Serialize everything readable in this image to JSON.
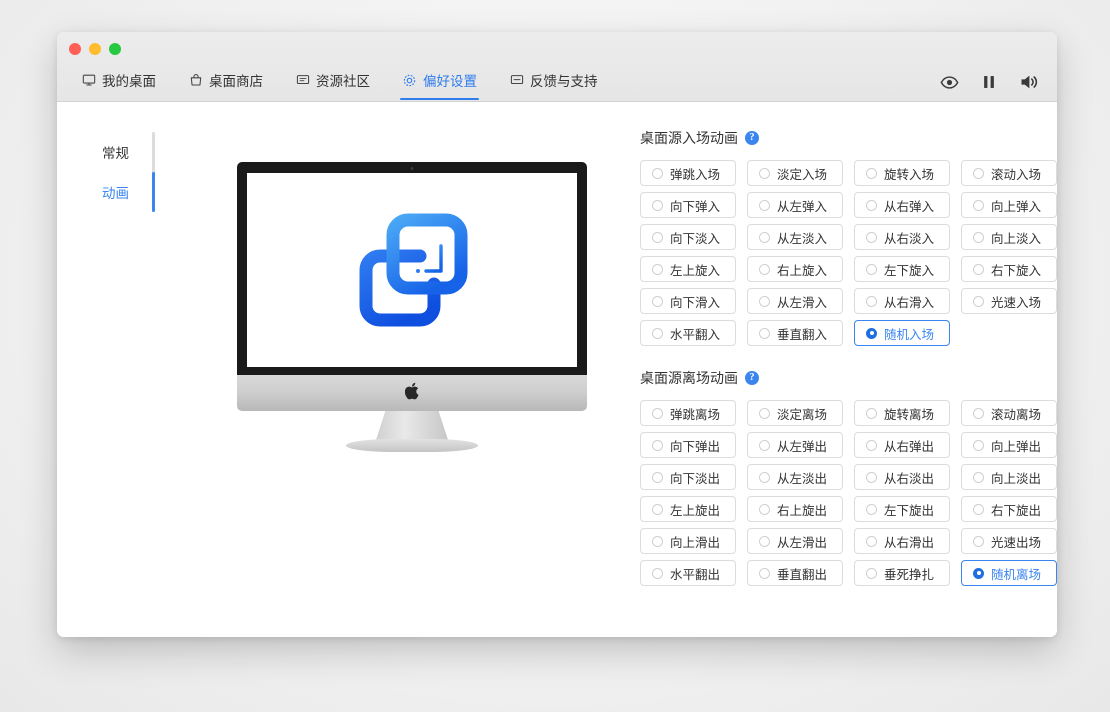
{
  "window": {
    "traffic_lights": [
      "close",
      "minimize",
      "maximize"
    ]
  },
  "tabs": [
    {
      "label": "我的桌面",
      "icon": "monitor-icon",
      "active": false
    },
    {
      "label": "桌面商店",
      "icon": "bag-icon",
      "active": false
    },
    {
      "label": "资源社区",
      "icon": "message-icon",
      "active": false
    },
    {
      "label": "偏好设置",
      "icon": "gear-icon",
      "active": true
    },
    {
      "label": "反馈与支持",
      "icon": "feedback-icon",
      "active": false
    }
  ],
  "toolbar_right": [
    {
      "name": "eye-icon"
    },
    {
      "name": "pause-icon"
    },
    {
      "name": "volume-icon"
    }
  ],
  "sidebar": {
    "items": [
      {
        "label": "常规",
        "active": false
      },
      {
        "label": "动画",
        "active": true
      }
    ]
  },
  "preview": {
    "device": "imac",
    "logo_alt": "desktop-source-logo"
  },
  "sections": [
    {
      "title": "桌面源入场动画",
      "help": "?",
      "options": [
        {
          "label": "弹跳入场",
          "selected": false
        },
        {
          "label": "淡定入场",
          "selected": false
        },
        {
          "label": "旋转入场",
          "selected": false
        },
        {
          "label": "滚动入场",
          "selected": false
        },
        {
          "label": "向下弹入",
          "selected": false
        },
        {
          "label": "从左弹入",
          "selected": false
        },
        {
          "label": "从右弹入",
          "selected": false
        },
        {
          "label": "向上弹入",
          "selected": false
        },
        {
          "label": "向下淡入",
          "selected": false
        },
        {
          "label": "从左淡入",
          "selected": false
        },
        {
          "label": "从右淡入",
          "selected": false
        },
        {
          "label": "向上淡入",
          "selected": false
        },
        {
          "label": "左上旋入",
          "selected": false
        },
        {
          "label": "右上旋入",
          "selected": false
        },
        {
          "label": "左下旋入",
          "selected": false
        },
        {
          "label": "右下旋入",
          "selected": false
        },
        {
          "label": "向下滑入",
          "selected": false
        },
        {
          "label": "从左滑入",
          "selected": false
        },
        {
          "label": "从右滑入",
          "selected": false
        },
        {
          "label": "光速入场",
          "selected": false
        },
        {
          "label": "水平翻入",
          "selected": false
        },
        {
          "label": "垂直翻入",
          "selected": false
        },
        {
          "label": "随机入场",
          "selected": true
        }
      ]
    },
    {
      "title": "桌面源离场动画",
      "help": "?",
      "options": [
        {
          "label": "弹跳离场",
          "selected": false
        },
        {
          "label": "淡定离场",
          "selected": false
        },
        {
          "label": "旋转离场",
          "selected": false
        },
        {
          "label": "滚动离场",
          "selected": false
        },
        {
          "label": "向下弹出",
          "selected": false
        },
        {
          "label": "从左弹出",
          "selected": false
        },
        {
          "label": "从右弹出",
          "selected": false
        },
        {
          "label": "向上弹出",
          "selected": false
        },
        {
          "label": "向下淡出",
          "selected": false
        },
        {
          "label": "从左淡出",
          "selected": false
        },
        {
          "label": "从右淡出",
          "selected": false
        },
        {
          "label": "向上淡出",
          "selected": false
        },
        {
          "label": "左上旋出",
          "selected": false
        },
        {
          "label": "右上旋出",
          "selected": false
        },
        {
          "label": "左下旋出",
          "selected": false
        },
        {
          "label": "右下旋出",
          "selected": false
        },
        {
          "label": "向上滑出",
          "selected": false
        },
        {
          "label": "从左滑出",
          "selected": false
        },
        {
          "label": "从右滑出",
          "selected": false
        },
        {
          "label": "光速出场",
          "selected": false
        },
        {
          "label": "水平翻出",
          "selected": false
        },
        {
          "label": "垂直翻出",
          "selected": false
        },
        {
          "label": "垂死挣扎",
          "selected": false
        },
        {
          "label": "随机离场",
          "selected": true
        }
      ]
    }
  ],
  "colors": {
    "accent": "#3a85f0",
    "accent_dark": "#1f6fe0",
    "text": "#333333",
    "border": "#dcdcdc",
    "titlebar": "#ececec"
  }
}
